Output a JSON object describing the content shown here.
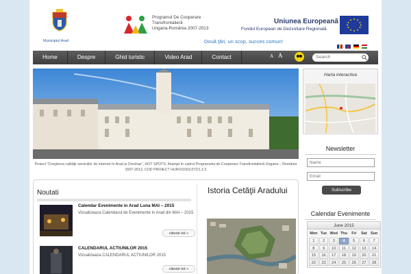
{
  "header": {
    "city_label": "Municipiul Arad",
    "program_lines": [
      "Programul De Cooperare",
      "Transfrontalieră",
      "Ungaria-România 2007-2013"
    ],
    "eu_title": "Uniunea Europeană",
    "eu_subtitle": "Fondul European de Dezvoltare Regională",
    "slogan": "Două ţări, un scop, succes comun!"
  },
  "nav": {
    "items": [
      "Home",
      "Despre",
      "Ghid turistic",
      "Video Arad",
      "Contact"
    ],
    "font_small": "A",
    "font_large": "A",
    "search_placeholder": "Search"
  },
  "hero": {
    "caption": "Proiect \"Creşterea calităţii serviciilor de internet în Arad şi Oroshaz\", HOT SPOTS, finanţat în cadrul Programului de Cooperare Transfrontalieră Ungaria – România 2007-2013, COD PROIECT HURO/1001/272/1.2.2"
  },
  "map": {
    "title": "Harta interactiva"
  },
  "newsletter": {
    "title": "Newsletter",
    "name_placeholder": "Name",
    "email_placeholder": "Email",
    "subscribe_label": "Subscribe"
  },
  "calendar": {
    "title": "Calendar Evenimente",
    "month": "June 2015",
    "weekdays": [
      "Mon",
      "Tue",
      "Wed",
      "Thu",
      "Fri",
      "Sat",
      "Sun"
    ],
    "days": [
      "1",
      "2",
      "3",
      "4",
      "5",
      "6",
      "7",
      "8",
      "9",
      "10",
      "11",
      "12",
      "13",
      "14",
      "15",
      "16",
      "17",
      "18",
      "19",
      "20",
      "21",
      "22",
      "23",
      "24",
      "25",
      "26",
      "27",
      "28"
    ],
    "today": "4"
  },
  "news": {
    "title": "Noutati",
    "items": [
      {
        "title": "Calendar Evenimente in Arad Luna MAI – 2015",
        "text": "Vizualizeaza Calendarul de Evenimente in Arad din MAI – 2015",
        "more": "citeste tot »"
      },
      {
        "title": "CALENDARUL ACTIUNILOR 2015",
        "text": "Vizualizeaza CALENDARUL ACTIUNILOR 2015",
        "more": "citeste tot »"
      }
    ]
  },
  "story": {
    "title": "Istoria Cetăţii Aradului"
  },
  "colors": {
    "nav_bg": "#4a4a4a",
    "accent_blue": "#2f79c4",
    "eu_blue": "#1e3a9a",
    "page_bg": "#d9e7f3"
  }
}
